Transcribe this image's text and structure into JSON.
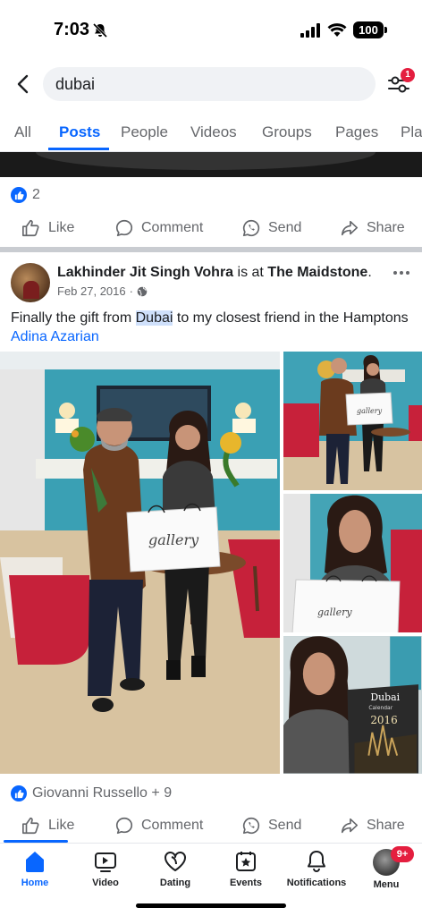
{
  "status_bar": {
    "time": "7:03",
    "battery": "100"
  },
  "search": {
    "query": "dubai",
    "filter_badge": "1"
  },
  "tabs": [
    {
      "label": "All"
    },
    {
      "label": "Posts"
    },
    {
      "label": "People"
    },
    {
      "label": "Videos"
    },
    {
      "label": "Groups"
    },
    {
      "label": "Pages"
    },
    {
      "label": "Pla"
    }
  ],
  "previous_post": {
    "reaction_count": "2"
  },
  "actions": {
    "like": "Like",
    "comment": "Comment",
    "send": "Send",
    "share": "Share"
  },
  "post": {
    "author": "Lakhinder Jit Singh Vohra",
    "connector": " is at ",
    "place": "The Maidstone",
    "place_suffix": ".",
    "date": "Feb 27, 2016",
    "date_separator": "·",
    "text_before": "Finally the gift from ",
    "text_highlight": "Dubai",
    "text_after": " to my closest friend in the Hamptons ",
    "mention": "Adina Azarian",
    "bag_text": "gallery",
    "calendar_title": "Dubai",
    "calendar_subtitle": "Calendar",
    "calendar_year": "2016",
    "reactions": "Giovanni Russello + 9"
  },
  "bottom_nav": {
    "home": "Home",
    "video": "Video",
    "dating": "Dating",
    "events": "Events",
    "notifications": "Notifications",
    "menu": "Menu",
    "menu_badge": "9+"
  },
  "colors": {
    "accent": "#0866ff",
    "badge": "#e41e3f",
    "secondary_text": "#65676b"
  }
}
